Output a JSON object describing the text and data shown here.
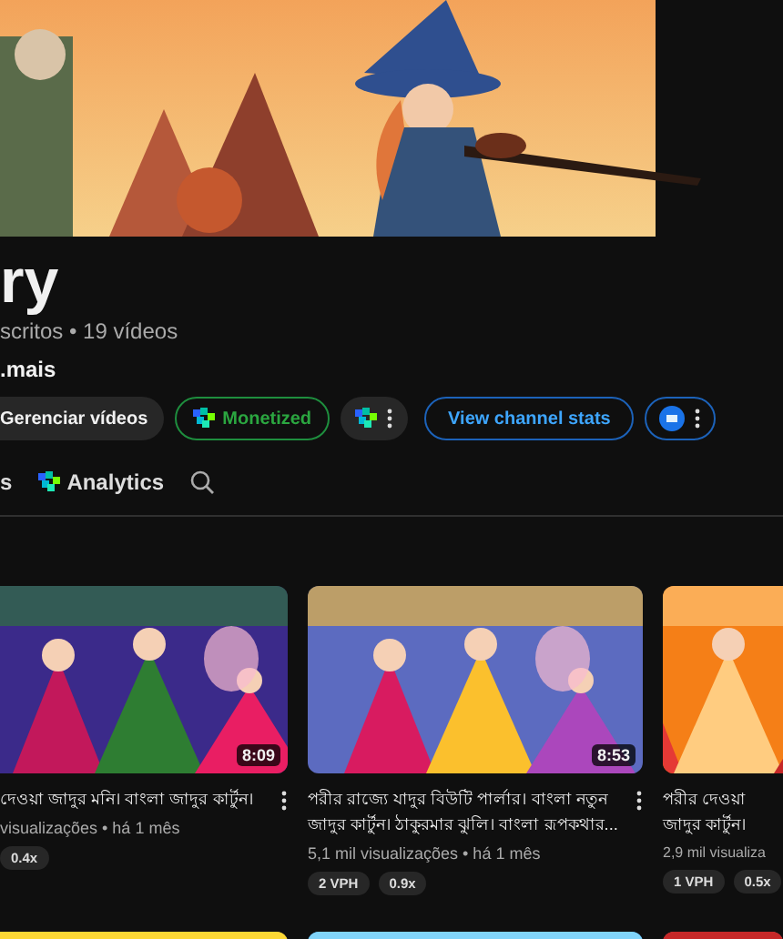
{
  "channel": {
    "name": "ry",
    "stats": "scritos • 19 vídeos",
    "more": ".mais"
  },
  "actions": [
    {
      "kind": "plain",
      "label": "Gerenciar vídeos"
    },
    {
      "kind": "monetized",
      "label": "Monetized"
    },
    {
      "kind": "logo-menu"
    },
    {
      "kind": "outline",
      "label": "View channel stats"
    },
    {
      "kind": "avatar-menu"
    }
  ],
  "tabs": [
    {
      "label": "s",
      "icon": false
    },
    {
      "label": "Analytics",
      "icon": true
    }
  ],
  "videos": [
    {
      "title_lines": [
        "দেওয়া জাদুর মনি। বাংলা জাদুর কার্টুন।"
      ],
      "meta": "visualizações • há 1 mês",
      "chips": [
        "0.4x"
      ],
      "duration": "8:09",
      "menu": true
    },
    {
      "title_lines": [
        "পরীর রাজ্যে যাদুর বিউটি পার্লার। বাংলা নতুন",
        "জাদুর কার্টুন। ঠাকুরমার ঝুলি। বাংলা রূপকথার..."
      ],
      "meta": "5,1 mil visualizações • há 1 mês",
      "chips": [
        "2 VPH",
        "0.9x"
      ],
      "duration": "8:53",
      "menu": true
    },
    {
      "title_lines": [
        "পরীর দেওয়া",
        "জাদুর কার্টুন।"
      ],
      "meta": "2,9 mil visualiza",
      "chips": [
        "1 VPH",
        "0.5x"
      ],
      "menu": false
    }
  ]
}
